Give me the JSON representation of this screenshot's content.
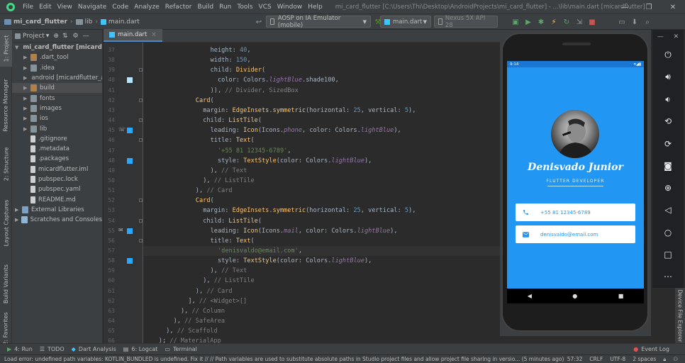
{
  "menubar": {
    "items": [
      "File",
      "Edit",
      "View",
      "Navigate",
      "Code",
      "Analyze",
      "Refactor",
      "Build",
      "Run",
      "Tools",
      "VCS",
      "Window",
      "Help"
    ],
    "window_title": "mi_card_flutter [C:\\Users\\Thi\\Desktop\\AndroidProjects\\mi_card_flutter] - ...\\lib\\main.dart [micardflutter]"
  },
  "navbar": {
    "breadcrumbs": [
      "mi_card_flutter",
      "lib",
      "main.dart"
    ],
    "device_combo": "AOSP on IA Emulator (mobile)",
    "run_config": "main.dart",
    "avd_combo": "Nexus 5X API 28"
  },
  "left_tabs": [
    "1: Project",
    "Resource Manager",
    "2: Structure",
    "Layout Captures",
    "Build Variants",
    "2: Favorites"
  ],
  "project": {
    "header": "Project",
    "tree": [
      {
        "label": "mi_card_flutter [micardflutter]",
        "depth": 0,
        "icon": "folder",
        "expanded": true
      },
      {
        "label": ".dart_tool",
        "depth": 1,
        "icon": "folder-brown"
      },
      {
        "label": ".idea",
        "depth": 1,
        "icon": "folder"
      },
      {
        "label": "android [micardflutter_android]",
        "depth": 1,
        "icon": "folder"
      },
      {
        "label": "build",
        "depth": 1,
        "icon": "folder-brown",
        "selected": true
      },
      {
        "label": "fonts",
        "depth": 1,
        "icon": "folder"
      },
      {
        "label": "images",
        "depth": 1,
        "icon": "folder"
      },
      {
        "label": "ios",
        "depth": 1,
        "icon": "folder"
      },
      {
        "label": "lib",
        "depth": 1,
        "icon": "folder"
      },
      {
        "label": ".gitignore",
        "depth": 1,
        "icon": "file"
      },
      {
        "label": ".metadata",
        "depth": 1,
        "icon": "file"
      },
      {
        "label": ".packages",
        "depth": 1,
        "icon": "file"
      },
      {
        "label": "micardflutter.iml",
        "depth": 1,
        "icon": "file"
      },
      {
        "label": "pubspec.lock",
        "depth": 1,
        "icon": "file"
      },
      {
        "label": "pubspec.yaml",
        "depth": 1,
        "icon": "file"
      },
      {
        "label": "README.md",
        "depth": 1,
        "icon": "file"
      },
      {
        "label": "External Libraries",
        "depth": 0,
        "icon": "lib"
      },
      {
        "label": "Scratches and Consoles",
        "depth": 0,
        "icon": "scratch"
      }
    ]
  },
  "editor": {
    "tab": "main.dart",
    "current_line": 57,
    "lines": [
      {
        "n": 37,
        "ind": 18,
        "t": [
          [
            "height: ",
            ""
          ],
          [
            "40",
            "num"
          ],
          [
            ",",
            ""
          ]
        ]
      },
      {
        "n": 38,
        "ind": 18,
        "t": [
          [
            "width: ",
            ""
          ],
          [
            "150",
            "num"
          ],
          [
            ",",
            ""
          ]
        ]
      },
      {
        "n": 39,
        "ind": 18,
        "t": [
          [
            "child: ",
            ""
          ],
          [
            "Divider",
            "fn"
          ],
          [
            "(",
            ""
          ]
        ]
      },
      {
        "n": 40,
        "ind": 20,
        "t": [
          [
            "color: Colors.",
            ""
          ],
          [
            "lightBlue",
            "it"
          ],
          [
            ".shade100,",
            ""
          ]
        ]
      },
      {
        "n": 41,
        "ind": 18,
        "t": [
          [
            ")), ",
            ""
          ],
          [
            "// Divider, SizedBox",
            "cm"
          ]
        ]
      },
      {
        "n": 42,
        "ind": 14,
        "t": [
          [
            "Card",
            "fn"
          ],
          [
            "(",
            ""
          ]
        ]
      },
      {
        "n": 43,
        "ind": 16,
        "t": [
          [
            "margin: ",
            ""
          ],
          [
            "EdgeInsets",
            "fn"
          ],
          [
            ".",
            ""
          ],
          [
            "symmetric",
            "fn"
          ],
          [
            "(horizontal: ",
            ""
          ],
          [
            "25",
            "num"
          ],
          [
            ", vertical: ",
            ""
          ],
          [
            "5",
            "num"
          ],
          [
            "),",
            ""
          ]
        ]
      },
      {
        "n": 44,
        "ind": 16,
        "t": [
          [
            "child: ",
            ""
          ],
          [
            "ListTile",
            "fn"
          ],
          [
            "(",
            ""
          ]
        ]
      },
      {
        "n": 45,
        "ind": 18,
        "t": [
          [
            "leading: ",
            ""
          ],
          [
            "Icon",
            "fn"
          ],
          [
            "(Icons.",
            ""
          ],
          [
            "phone",
            "it"
          ],
          [
            ", color: Colors.",
            ""
          ],
          [
            "lightBlue",
            "it"
          ],
          [
            "),",
            ""
          ]
        ]
      },
      {
        "n": 46,
        "ind": 18,
        "t": [
          [
            "title: ",
            ""
          ],
          [
            "Text",
            "fn"
          ],
          [
            "(",
            ""
          ]
        ]
      },
      {
        "n": 47,
        "ind": 20,
        "t": [
          [
            "'+55 81 12345-6789'",
            "str"
          ],
          [
            ",",
            ""
          ]
        ]
      },
      {
        "n": 48,
        "ind": 20,
        "t": [
          [
            "style: ",
            ""
          ],
          [
            "TextStyle",
            "fn"
          ],
          [
            "(color: Colors.",
            ""
          ],
          [
            "lightBlue",
            "it"
          ],
          [
            "),",
            ""
          ]
        ]
      },
      {
        "n": 49,
        "ind": 18,
        "t": [
          [
            "), ",
            ""
          ],
          [
            "// Text",
            "cm"
          ]
        ]
      },
      {
        "n": 50,
        "ind": 16,
        "t": [
          [
            "), ",
            ""
          ],
          [
            "// ListTile",
            "cm"
          ]
        ]
      },
      {
        "n": 51,
        "ind": 14,
        "t": [
          [
            "), ",
            ""
          ],
          [
            "// Card",
            "cm"
          ]
        ]
      },
      {
        "n": 52,
        "ind": 14,
        "t": [
          [
            "Card",
            "fn"
          ],
          [
            "(",
            ""
          ]
        ]
      },
      {
        "n": 53,
        "ind": 16,
        "t": [
          [
            "margin: ",
            ""
          ],
          [
            "EdgeInsets",
            "fn"
          ],
          [
            ".",
            ""
          ],
          [
            "symmetric",
            "fn"
          ],
          [
            "(horizontal: ",
            ""
          ],
          [
            "25",
            "num"
          ],
          [
            ", vertical: ",
            ""
          ],
          [
            "5",
            "num"
          ],
          [
            "),",
            ""
          ]
        ]
      },
      {
        "n": 54,
        "ind": 16,
        "t": [
          [
            "child: ",
            ""
          ],
          [
            "ListTile",
            "fn"
          ],
          [
            "(",
            ""
          ]
        ]
      },
      {
        "n": 55,
        "ind": 18,
        "t": [
          [
            "leading: ",
            ""
          ],
          [
            "Icon",
            "fn"
          ],
          [
            "(Icons.",
            ""
          ],
          [
            "mail",
            "it"
          ],
          [
            ", color: Colors.",
            ""
          ],
          [
            "lightBlue",
            "it"
          ],
          [
            "),",
            ""
          ]
        ]
      },
      {
        "n": 56,
        "ind": 18,
        "t": [
          [
            "title: ",
            ""
          ],
          [
            "Text",
            "fn"
          ],
          [
            "(",
            ""
          ]
        ]
      },
      {
        "n": 57,
        "ind": 20,
        "t": [
          [
            "'denisvaldo@email.com'",
            "str"
          ],
          [
            ",",
            ""
          ]
        ]
      },
      {
        "n": 58,
        "ind": 20,
        "t": [
          [
            "style: ",
            ""
          ],
          [
            "TextStyle",
            "fn"
          ],
          [
            "(color: Colors.",
            ""
          ],
          [
            "lightBlue",
            "it"
          ],
          [
            "),",
            ""
          ]
        ]
      },
      {
        "n": 59,
        "ind": 18,
        "t": [
          [
            "), ",
            ""
          ],
          [
            "// Text",
            "cm"
          ]
        ]
      },
      {
        "n": 60,
        "ind": 16,
        "t": [
          [
            "), ",
            ""
          ],
          [
            "// ListTile",
            "cm"
          ]
        ]
      },
      {
        "n": 61,
        "ind": 14,
        "t": [
          [
            "), ",
            ""
          ],
          [
            "// Card",
            "cm"
          ]
        ]
      },
      {
        "n": 62,
        "ind": 12,
        "t": [
          [
            "], ",
            ""
          ],
          [
            "// <Widget>[]",
            "cm"
          ]
        ]
      },
      {
        "n": 63,
        "ind": 10,
        "t": [
          [
            "), ",
            ""
          ],
          [
            "// Column",
            "cm"
          ]
        ]
      },
      {
        "n": 64,
        "ind": 8,
        "t": [
          [
            "), ",
            ""
          ],
          [
            "// SafeArea",
            "cm"
          ]
        ]
      },
      {
        "n": 65,
        "ind": 6,
        "t": [
          [
            "), ",
            ""
          ],
          [
            "// Scaffold",
            "cm"
          ]
        ]
      },
      {
        "n": 66,
        "ind": 4,
        "t": [
          [
            "); ",
            ""
          ],
          [
            "// MaterialApp",
            "cm"
          ]
        ]
      }
    ]
  },
  "phone": {
    "time": "9:14",
    "name": "Denisvado Junior",
    "job": "FLUTTER DEVELOPER",
    "phone": "+55 81 12345-6789",
    "email": "denisvaldo@email.com"
  },
  "right_tabs": [
    "Device File Explorer"
  ],
  "bottom_tabs": [
    {
      "label": "4: Run",
      "icon": "run-icon"
    },
    {
      "label": "TODO",
      "icon": "todo-icon"
    },
    {
      "label": "Dart Analysis",
      "icon": "dart-analysis-icon"
    },
    {
      "label": "6: Logcat",
      "icon": "logcat-icon"
    },
    {
      "label": "Terminal",
      "icon": "terminal-icon"
    }
  ],
  "event_log": "Event Log",
  "status": {
    "message": "Load error: undefined path variables: KOTLIN_BUNDLED is undefined. Fix it // // Path variables are used to substitute absolute paths in Studio project files and allow project file sharing in versio... (5 minutes ago)",
    "position": "57:32",
    "line_sep": "CRLF",
    "encoding": "UTF-8",
    "indent": "2 spaces"
  },
  "colors": {
    "accent": "#2196f3",
    "editor_bg": "#2b2b2b",
    "panel_bg": "#3c3f41"
  }
}
